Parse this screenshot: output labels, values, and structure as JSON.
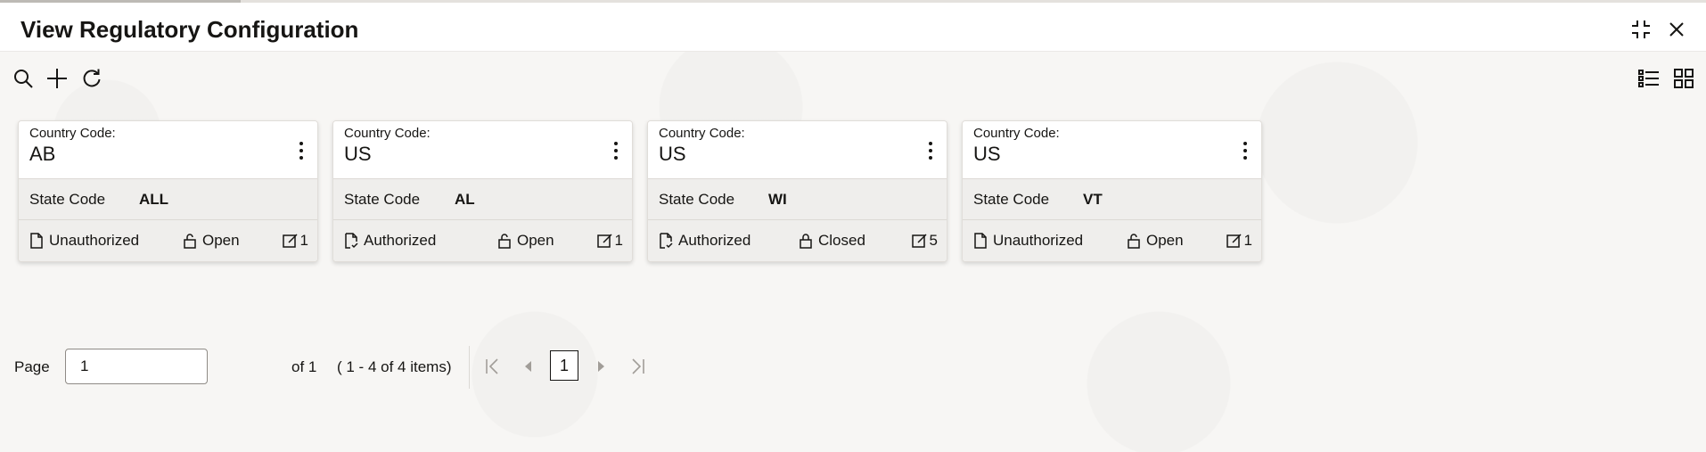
{
  "header": {
    "title": "View Regulatory Configuration"
  },
  "icons": {
    "minimize": "minimize-icon",
    "close": "close-icon",
    "search": "search-icon",
    "add": "plus-icon",
    "refresh": "refresh-icon",
    "list_view": "list-view-icon",
    "grid_view": "grid-view-icon"
  },
  "cards": [
    {
      "country_code_label": "Country Code:",
      "country_code": "AB",
      "state_code_label": "State Code",
      "state_code": "ALL",
      "auth_status": "Unauthorized",
      "record_status": "Open",
      "modifications": "1"
    },
    {
      "country_code_label": "Country Code:",
      "country_code": "US",
      "state_code_label": "State Code",
      "state_code": "AL",
      "auth_status": "Authorized",
      "record_status": "Open",
      "modifications": "1"
    },
    {
      "country_code_label": "Country Code:",
      "country_code": "US",
      "state_code_label": "State Code",
      "state_code": "WI",
      "auth_status": "Authorized",
      "record_status": "Closed",
      "modifications": "5"
    },
    {
      "country_code_label": "Country Code:",
      "country_code": "US",
      "state_code_label": "State Code",
      "state_code": "VT",
      "auth_status": "Unauthorized",
      "record_status": "Open",
      "modifications": "1"
    }
  ],
  "pagination": {
    "page_label": "Page",
    "page_value": "1",
    "of_text": "of 1",
    "range_text": "( 1 - 4 of 4 items)",
    "current_page": "1"
  }
}
